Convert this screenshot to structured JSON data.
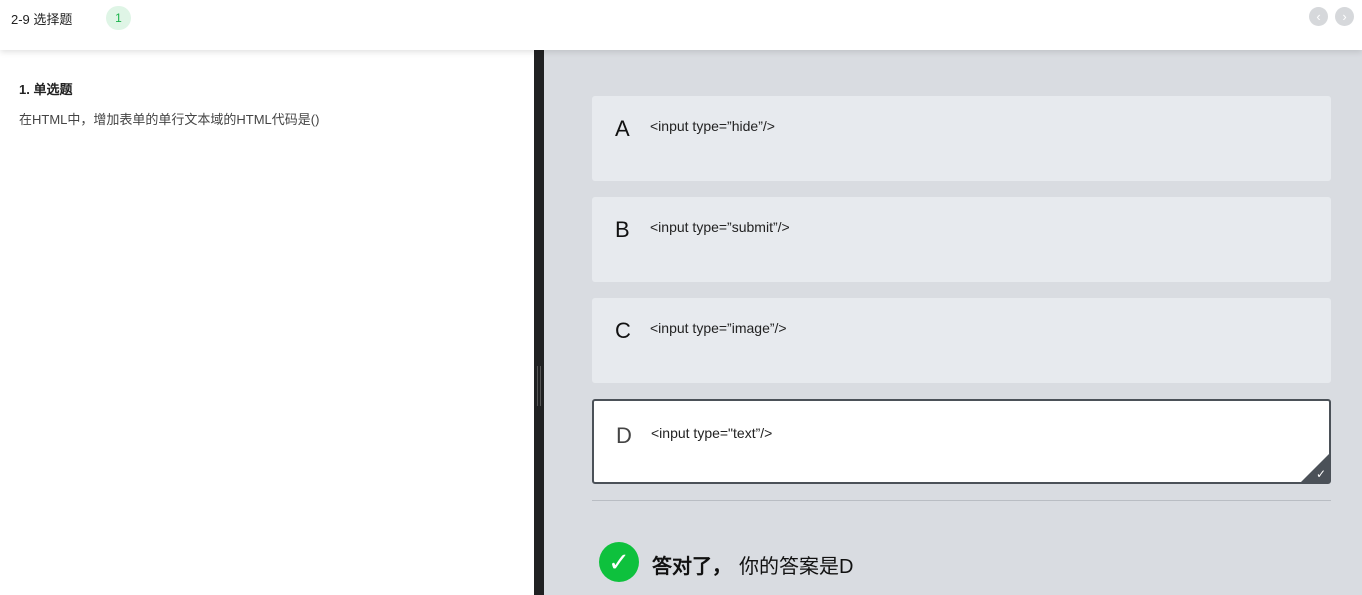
{
  "header": {
    "title": "2-9 选择题",
    "badge": "1",
    "prev_icon": "chevron-left-icon",
    "next_icon": "chevron-right-icon"
  },
  "question": {
    "type_label": "1. 单选题",
    "text": "在HTML中，增加表单的单行文本域的HTML代码是()"
  },
  "options": [
    {
      "letter": "A",
      "code": "<input type=”hide”/>"
    },
    {
      "letter": "B",
      "code": "<input type=”submit”/>"
    },
    {
      "letter": "C",
      "code": "<input type=”image”/>"
    },
    {
      "letter": "D",
      "code": "<input type=\"text”/>"
    }
  ],
  "selected_option": "D",
  "result": {
    "correct_label": "答对了，",
    "answer_label": "你的答案是D"
  },
  "colors": {
    "correct_green": "#0ec13d",
    "right_pane_bg": "#d9dce1",
    "option_bg": "#e7eaee",
    "selected_border": "#4b5158"
  }
}
